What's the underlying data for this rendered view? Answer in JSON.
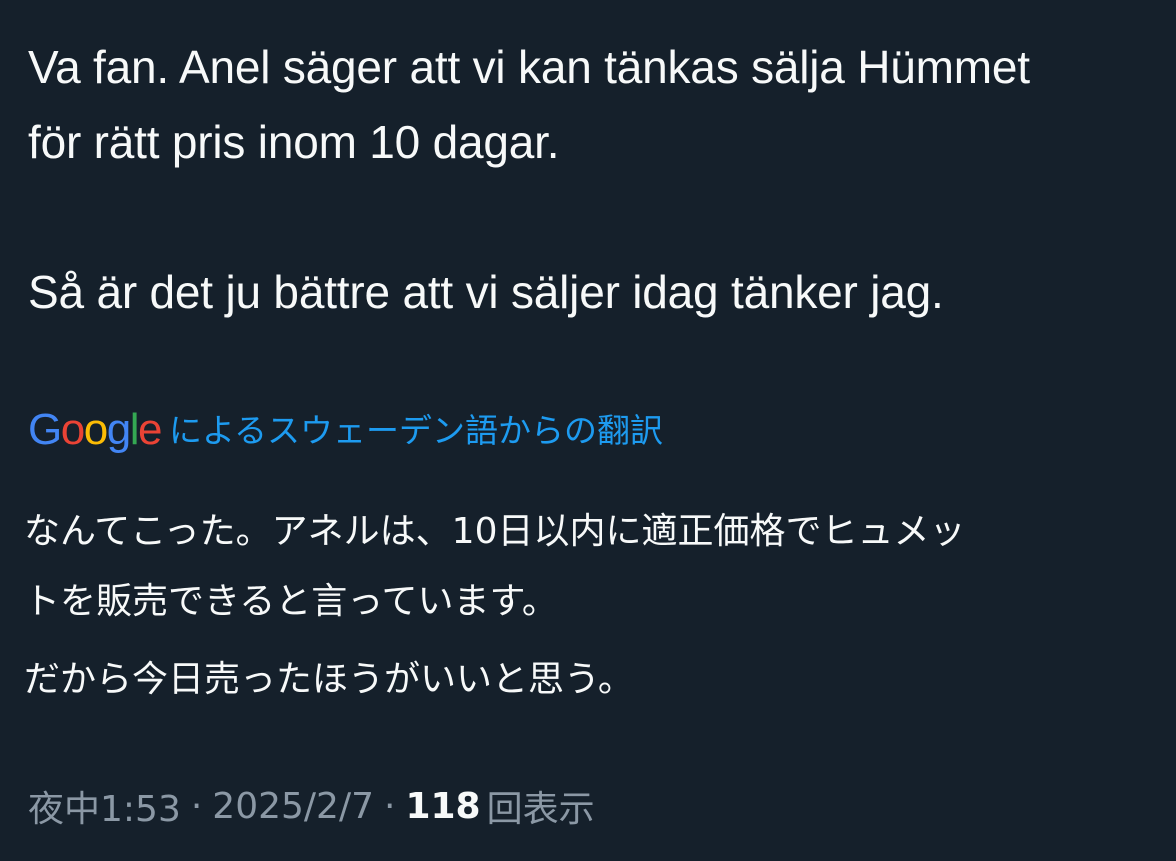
{
  "tweet": {
    "text_line1": "Va fan. Anel säger att vi kan tänkas sälja Hümmet",
    "text_line2": "för rätt pris inom 10 dagar.",
    "text_line3": "Så är det ju bättre att vi säljer idag tänker jag."
  },
  "translation": {
    "logo_text": "Google",
    "label": "によるスウェーデン語からの翻訳",
    "line1": "なんてこった。アネルは、10日以内に適正価格でヒュメッ",
    "line1b": "トを販売できると言っています。",
    "line2": "だから今日売ったほうがいいと思う。"
  },
  "meta": {
    "time": "夜中1:53",
    "separator": "·",
    "date": "2025/2/7",
    "views_count": "118",
    "views_label": "回表示"
  },
  "colors": {
    "background": "#15202b",
    "text": "#f7f9f9",
    "link": "#1d9bf0",
    "muted": "#8b98a5"
  }
}
